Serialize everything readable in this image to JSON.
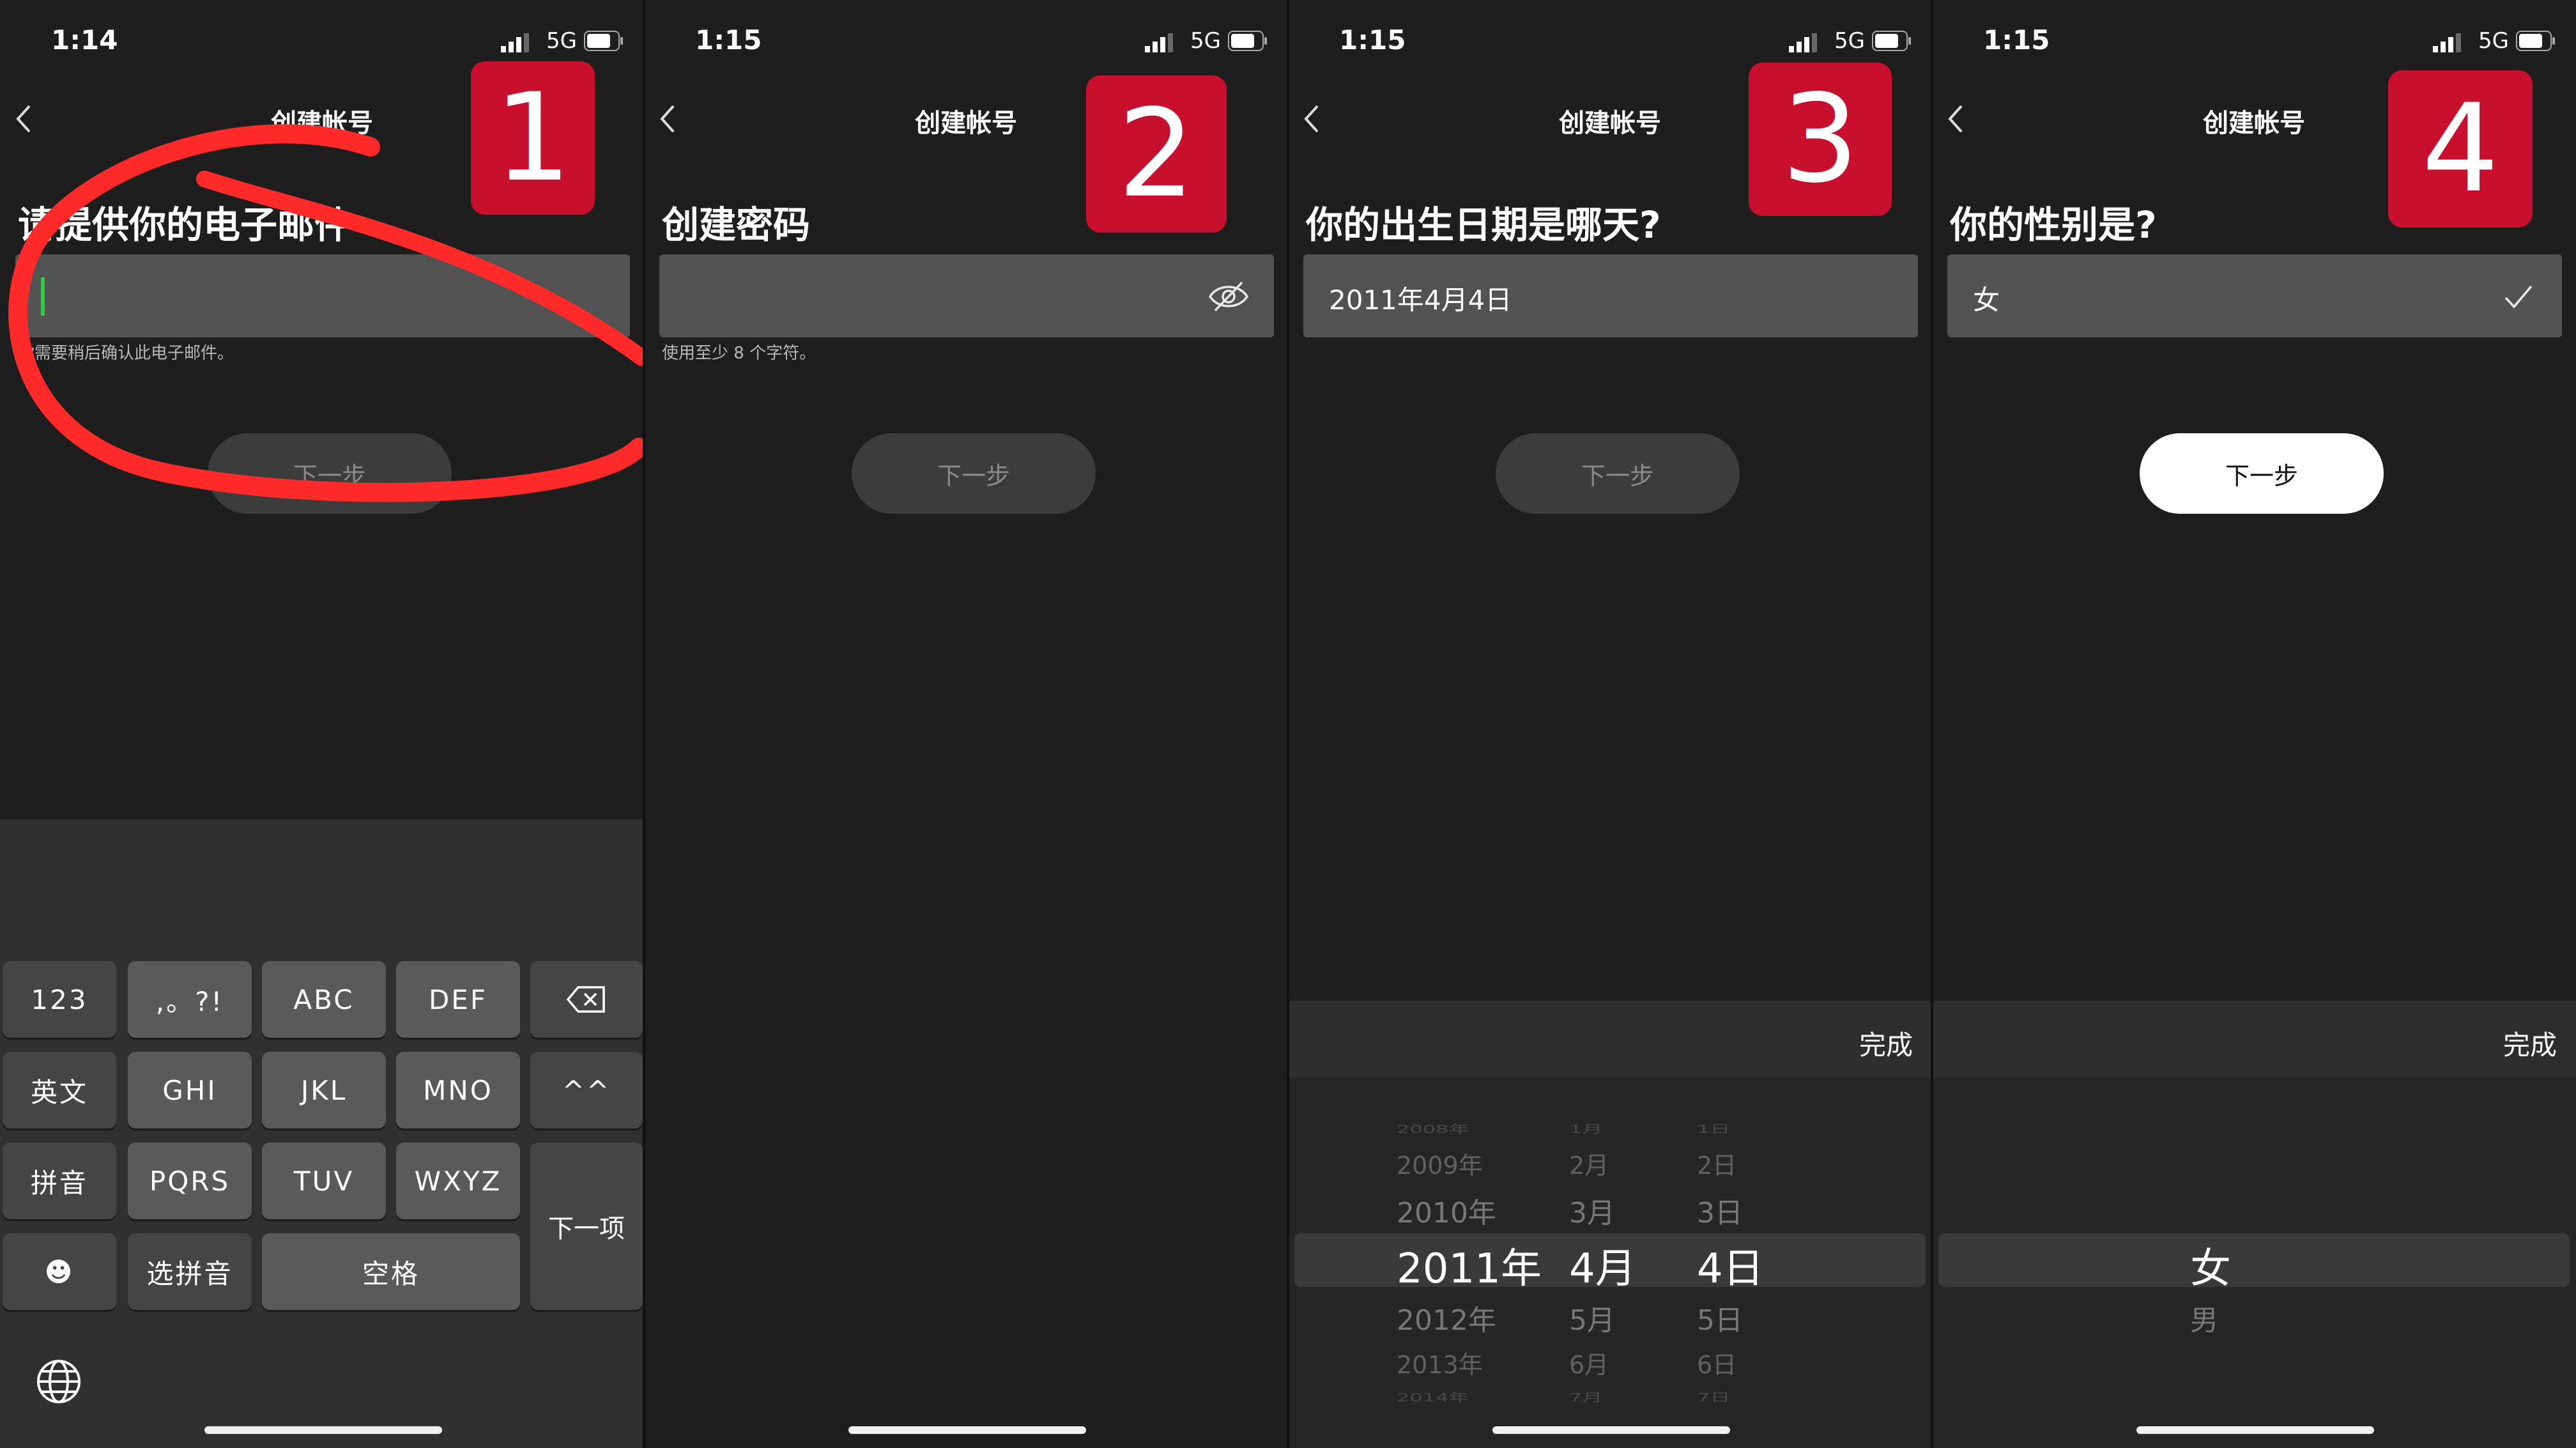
{
  "colors": {
    "badge": "#c8102e",
    "scribble": "#ff2a2a",
    "cursor": "#2ecc40"
  },
  "panels": [
    {
      "time": "1:14",
      "network": "5G",
      "title": "创建帐号",
      "badge": "1",
      "heading": "请提供你的电子邮件",
      "field_value": "",
      "hint": "你需要稍后确认此电子邮件。",
      "next_label": "下一步"
    },
    {
      "time": "1:15",
      "network": "5G",
      "title": "创建帐号",
      "badge": "2",
      "heading": "创建密码",
      "field_value": "",
      "field_icon": "eye-slash-icon",
      "hint": "使用至少 8 个字符。",
      "next_label": "下一步"
    },
    {
      "time": "1:15",
      "network": "5G",
      "title": "创建帐号",
      "badge": "3",
      "heading": "你的出生日期是哪天?",
      "field_value": "2011年4月4日",
      "hint": "",
      "next_label": "下一步",
      "done_label": "完成"
    },
    {
      "time": "1:15",
      "network": "5G",
      "title": "创建帐号",
      "badge": "4",
      "heading": "你的性别是?",
      "field_value": "女",
      "field_icon": "checkmark-icon",
      "hint": "",
      "next_label": "下一步",
      "done_label": "完成"
    }
  ],
  "keyboard": {
    "rows": [
      [
        "123",
        ",。?!",
        "ABC",
        "DEF",
        "⌫"
      ],
      [
        "英文",
        "GHI",
        "JKL",
        "MNO",
        "^^"
      ],
      [
        "拼音",
        "PQRS",
        "TUV",
        "WXYZ"
      ],
      [
        "☻",
        "选拼音",
        "空格"
      ]
    ],
    "next_item": "下一项",
    "globe": "globe-icon"
  },
  "date_picker": {
    "years": [
      "2008年",
      "2009年",
      "2010年",
      "2011年",
      "2012年",
      "2013年",
      "2014年"
    ],
    "months": [
      "1月",
      "2月",
      "3月",
      "4月",
      "5月",
      "6月",
      "7月"
    ],
    "days": [
      "1日",
      "2日",
      "3日",
      "4日",
      "5日",
      "6日",
      "7日"
    ],
    "selected_index": 3
  },
  "gender_picker": {
    "options": [
      "女",
      "男"
    ],
    "selected_index": 0
  }
}
